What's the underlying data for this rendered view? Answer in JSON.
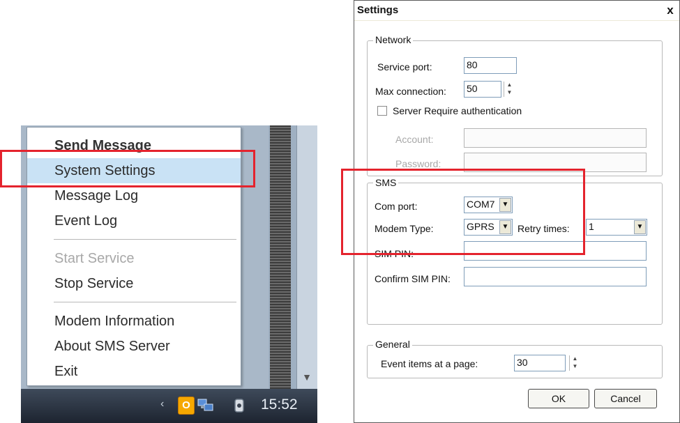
{
  "context_menu": {
    "items": [
      {
        "label": "Send Message"
      },
      {
        "label": "System Settings"
      },
      {
        "label": "Message Log"
      },
      {
        "label": "Event Log"
      },
      {
        "label": "Start Service"
      },
      {
        "label": "Stop Service"
      },
      {
        "label": "Modem Information"
      },
      {
        "label": "About SMS Server"
      },
      {
        "label": "Exit"
      }
    ]
  },
  "taskbar": {
    "tray_app_letter": "O",
    "clock": "15:52"
  },
  "settings": {
    "title": "Settings",
    "close": "x",
    "network": {
      "legend": "Network",
      "service_port_label": "Service port:",
      "service_port_value": "80",
      "max_connection_label": "Max connection:",
      "max_connection_value": "50",
      "auth_label": "Server Require authentication",
      "auth_checked": false,
      "account_label": "Account:",
      "password_label": "Password:"
    },
    "sms": {
      "legend": "SMS",
      "com_port_label": "Com port:",
      "com_port_value": "COM7",
      "modem_type_label": "Modem Type:",
      "modem_type_value": "GPRS",
      "retry_label": "Retry times:",
      "retry_value": "1",
      "sim_pin_label": "SIM PIN:",
      "confirm_sim_pin_label": "Confirm SIM PIN:"
    },
    "general": {
      "legend": "General",
      "event_items_label": "Event items at a page:",
      "event_items_value": "30"
    },
    "ok_label": "OK",
    "cancel_label": "Cancel"
  },
  "colors": {
    "highlight_box": "#e4232d",
    "menu_selected": "#c9e2f5"
  }
}
